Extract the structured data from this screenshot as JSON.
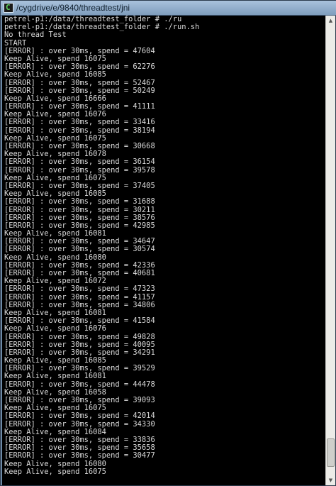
{
  "window": {
    "title": "/cygdrive/e/9840/threadtest/jni",
    "background_tabs": [
      "",
      "",
      ""
    ],
    "icon": "terminal-icon"
  },
  "terminal": {
    "lines": [
      "petrel-p1:/data/threadtest_folder # ./ru",
      "petrel-p1:/data/threadtest_folder # ./run.sh",
      "No thread Test",
      "START",
      "[ERROR] : over 30ms, spend = 47604",
      "Keep Alive, spend 16075",
      "[ERROR] : over 30ms, spend = 62276",
      "Keep Alive, spend 16085",
      "[ERROR] : over 30ms, spend = 52467",
      "[ERROR] : over 30ms, spend = 50249",
      "Keep Alive, spend 16666",
      "[ERROR] : over 30ms, spend = 41111",
      "Keep Alive, spend 16076",
      "[ERROR] : over 30ms, spend = 33416",
      "[ERROR] : over 30ms, spend = 38194",
      "Keep Alive, spend 16075",
      "[ERROR] : over 30ms, spend = 30668",
      "Keep Alive, spend 16078",
      "[ERROR] : over 30ms, spend = 36154",
      "[ERROR] : over 30ms, spend = 39578",
      "Keep Alive, spend 16075",
      "[ERROR] : over 30ms, spend = 37405",
      "Keep Alive, spend 16085",
      "[ERROR] : over 30ms, spend = 31688",
      "[ERROR] : over 30ms, spend = 30211",
      "[ERROR] : over 30ms, spend = 38576",
      "[ERROR] : over 30ms, spend = 42985",
      "Keep Alive, spend 16081",
      "[ERROR] : over 30ms, spend = 34647",
      "[ERROR] : over 30ms, spend = 30574",
      "Keep Alive, spend 16080",
      "[ERROR] : over 30ms, spend = 42336",
      "[ERROR] : over 30ms, spend = 40681",
      "Keep Alive, spend 16072",
      "[ERROR] : over 30ms, spend = 47323",
      "[ERROR] : over 30ms, spend = 41157",
      "[ERROR] : over 30ms, spend = 34806",
      "Keep Alive, spend 16081",
      "[ERROR] : over 30ms, spend = 41584",
      "Keep Alive, spend 16076",
      "[ERROR] : over 30ms, spend = 49828",
      "[ERROR] : over 30ms, spend = 40095",
      "[ERROR] : over 30ms, spend = 34291",
      "Keep Alive, spend 16085",
      "[ERROR] : over 30ms, spend = 39529",
      "Keep Alive, spend 16081",
      "[ERROR] : over 30ms, spend = 44478",
      "Keep Alive, spend 16058",
      "[ERROR] : over 30ms, spend = 39093",
      "Keep Alive, spend 16075",
      "[ERROR] : over 30ms, spend = 42014",
      "[ERROR] : over 30ms, spend = 34330",
      "Keep Alive, spend 16084",
      "[ERROR] : over 30ms, spend = 33836",
      "[ERROR] : over 30ms, spend = 35658",
      "[ERROR] : over 30ms, spend = 30477",
      "Keep Alive, spend 16080",
      "Keep Alive, spend 16075"
    ]
  },
  "scrollbar": {
    "up_icon": "arrow-up-icon",
    "down_icon": "arrow-down-icon",
    "position": 0.98
  },
  "colors": {
    "terminal_bg": "#000000",
    "terminal_fg": "#dcdcdc",
    "titlebar": "#9bb6d2"
  }
}
